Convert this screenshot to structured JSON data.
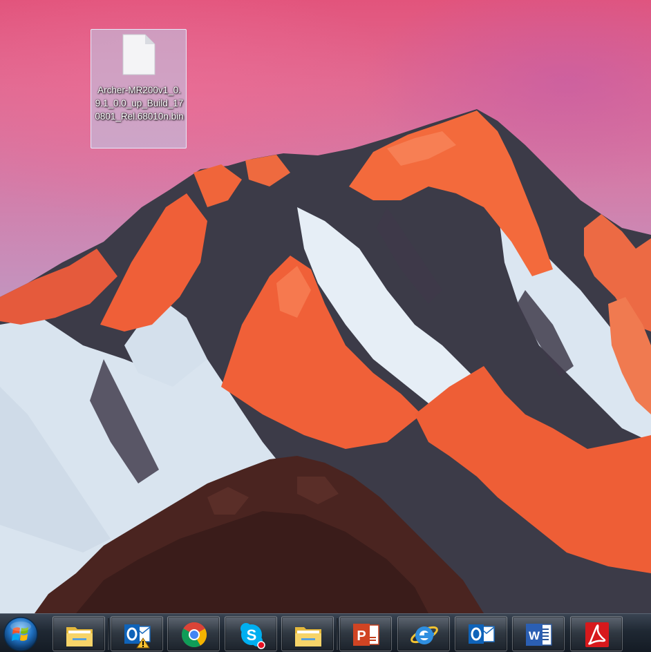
{
  "desktop": {
    "icons": [
      {
        "label": "Archer-MR200v1_0.9.1_0.0_up_Build_170801_Rel.68010n.bin",
        "icon": "document-icon"
      }
    ]
  },
  "taskbar": {
    "start_icon": "windows-start-icon",
    "pinned": [
      {
        "icon": "folder-icon"
      },
      {
        "icon": "outlook-warning-icon"
      },
      {
        "icon": "chrome-icon"
      },
      {
        "icon": "skype-icon"
      },
      {
        "icon": "folder-icon"
      },
      {
        "icon": "powerpoint-icon"
      },
      {
        "icon": "internet-explorer-icon"
      },
      {
        "icon": "outlook-icon"
      },
      {
        "icon": "word-icon"
      },
      {
        "icon": "acrobat-icon"
      }
    ]
  },
  "colors": {
    "sky_top": "#e2547c",
    "sky_bottom": "#9bb4d2",
    "mountain_lit": "#f0603a",
    "mountain_shadow": "#3c3b48",
    "snow": "#e6eef6",
    "taskbar": "#1f2833"
  }
}
